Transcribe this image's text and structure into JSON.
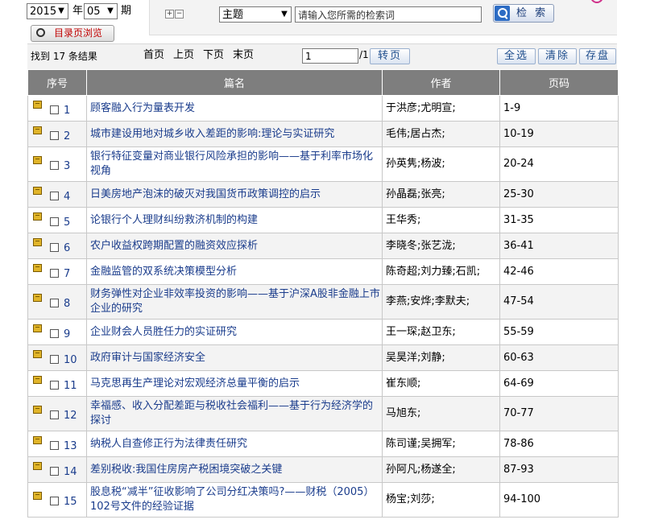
{
  "filters": {
    "year": "2015",
    "year_label": "年",
    "issue": "05",
    "issue_label": "期",
    "catalog_button": "目录页浏览"
  },
  "search": {
    "field": "主题",
    "placeholder": "请输入您所需的检索词",
    "button": "检 索"
  },
  "toolbar": {
    "found": "找到 17 条结果",
    "first": "首页",
    "prev": "上页",
    "next": "下页",
    "last": "末页",
    "page_value": "1",
    "page_total": "/1",
    "goto": "转页",
    "select_all": "全选",
    "clear": "清除",
    "save": "存盘"
  },
  "table": {
    "headers": [
      "序号",
      "篇名",
      "作者",
      "页码"
    ],
    "rows": [
      {
        "no": "1",
        "title": "顾客融入行为量表开发",
        "author": "于洪彦;尤明宣;",
        "pages": "1-9"
      },
      {
        "no": "2",
        "title": "城市建设用地对城乡收入差距的影响:理论与实证研究",
        "author": "毛伟;居占杰;",
        "pages": "10-19"
      },
      {
        "no": "3",
        "title": "银行特征变量对商业银行风险承担的影响——基于利率市场化视角",
        "author": "孙英隽;杨波;",
        "pages": "20-24"
      },
      {
        "no": "4",
        "title": "日美房地产泡沫的破灭对我国货币政策调控的启示",
        "author": "孙晶磊;张亮;",
        "pages": "25-30"
      },
      {
        "no": "5",
        "title": "论银行个人理财纠纷救济机制的构建",
        "author": "王华秀;",
        "pages": "31-35"
      },
      {
        "no": "6",
        "title": "农户收益权跨期配置的融资效应探析",
        "author": "李晓冬;张艺泷;",
        "pages": "36-41"
      },
      {
        "no": "7",
        "title": "金融监管的双系统决策模型分析",
        "author": "陈奇超;刘力臻;石凯;",
        "pages": "42-46"
      },
      {
        "no": "8",
        "title": "财务弹性对企业非效率投资的影响——基于沪深A股非金融上市企业的研究",
        "author": "李燕;安烨;李默夫;",
        "pages": "47-54"
      },
      {
        "no": "9",
        "title": "企业财会人员胜任力的实证研究",
        "author": "王一琛;赵卫东;",
        "pages": "55-59"
      },
      {
        "no": "10",
        "title": "政府审计与国家经济安全",
        "author": "吴昊洋;刘静;",
        "pages": "60-63"
      },
      {
        "no": "11",
        "title": "马克思再生产理论对宏观经济总量平衡的启示",
        "author": "崔东顺;",
        "pages": "64-69"
      },
      {
        "no": "12",
        "title": "幸福感、收入分配差距与税收社会福利——基于行为经济学的探讨",
        "author": "马旭东;",
        "pages": "70-77"
      },
      {
        "no": "13",
        "title": "纳税人自查修正行为法律责任研究",
        "author": "陈司谨;吴拥军;",
        "pages": "78-86"
      },
      {
        "no": "14",
        "title": "差别税收:我国住房房产税困境突破之关键",
        "author": "孙阿凡;杨遂全;",
        "pages": "87-93"
      },
      {
        "no": "15",
        "title": "股息税“减半”征收影响了公司分红决策吗?——财税（2005）102号文件的经验证据",
        "author": "杨宝;刘莎;",
        "pages": "94-100"
      }
    ]
  }
}
